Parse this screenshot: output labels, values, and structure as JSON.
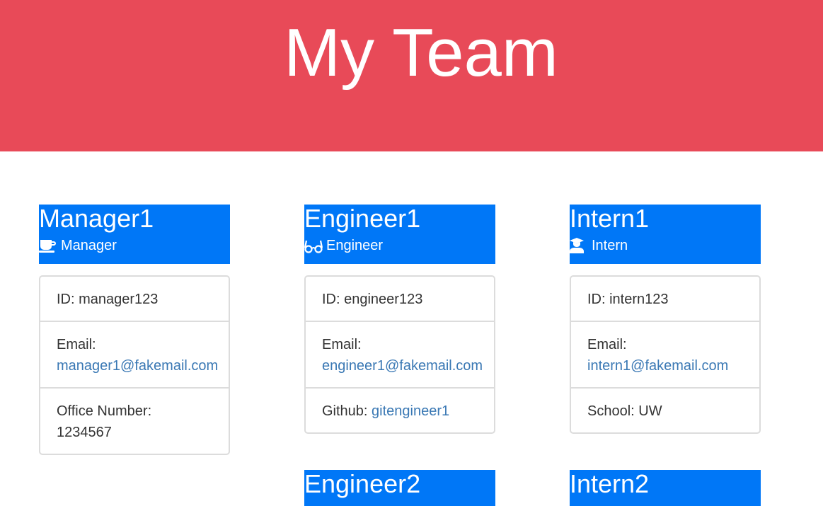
{
  "header": {
    "title": "My Team"
  },
  "colors": {
    "banner": "#e84a58",
    "card_header": "#0077f7",
    "link": "#3a78b4"
  },
  "cards": [
    {
      "name": "Manager1",
      "role": "Manager",
      "role_icon": "coffee-icon",
      "id_label": "ID: manager123",
      "email_label": "Email:",
      "email": "manager1@fakemail.com",
      "extra_label": "Office Number:",
      "extra_value": "1234567"
    },
    {
      "name": "Engineer1",
      "role": "Engineer",
      "role_icon": "glasses-icon",
      "id_label": "ID: engineer123",
      "email_label": "Email:",
      "email": "engineer1@fakemail.com",
      "extra_label": "Github:",
      "extra_value": "gitengineer1"
    },
    {
      "name": "Intern1",
      "role": "Intern",
      "role_icon": "graduate-icon",
      "id_label": "ID: intern123",
      "email_label": "Email:",
      "email": "intern1@fakemail.com",
      "extra_label": "School: UW"
    },
    {
      "name": "Engineer2"
    },
    {
      "name": "Intern2"
    }
  ]
}
